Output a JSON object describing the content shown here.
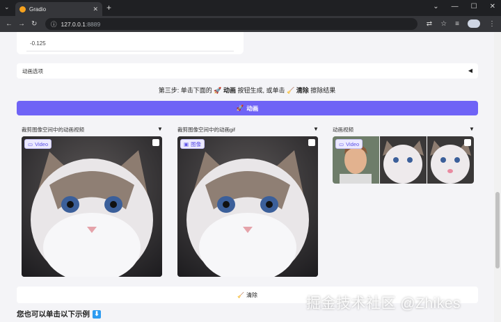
{
  "browser": {
    "tab_title": "Gradio",
    "url_host": "127.0.0.1",
    "url_port": ":8889"
  },
  "page": {
    "value_text": "-0.125",
    "accordion_label": "动画选项",
    "step3_prefix": "第三步: 单击下面的",
    "step3_icon1": "🚀",
    "step3_btn1": "动画",
    "step3_mid": "按钮生成, 或单击",
    "step3_icon2": "🧹",
    "step3_btn2": "清除",
    "step3_suffix": "擦除结果",
    "animate_button": "动画",
    "animate_icon": "🚀",
    "columns": [
      {
        "label": "裁剪图像空间中的动画视频",
        "badge": "Video"
      },
      {
        "label": "裁剪图像空间中的动画gif",
        "badge": "图像"
      },
      {
        "label": "动画视频",
        "badge": "Video"
      }
    ],
    "clear_button": "清除",
    "clear_icon": "🧹",
    "examples_heading": "您也可以单击以下示例",
    "watermark": "掘金技术社区 @Zhikes"
  }
}
